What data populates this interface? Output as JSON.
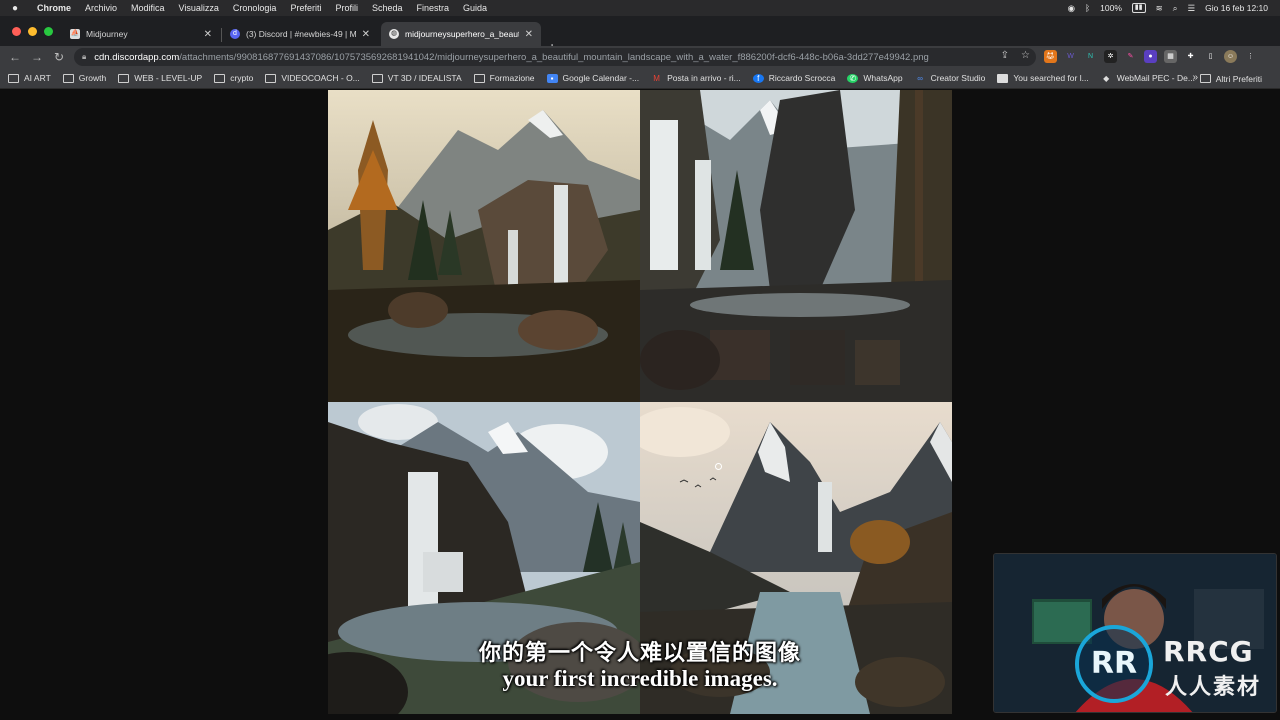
{
  "menubar": {
    "app": "Chrome",
    "items": [
      "Archivio",
      "Modifica",
      "Visualizza",
      "Cronologia",
      "Preferiti",
      "Profili",
      "Scheda",
      "Finestra",
      "Guida"
    ],
    "battery": "100%",
    "datetime": "Gio 16 feb  12:10"
  },
  "tabs": [
    {
      "title": "Midjourney",
      "active": false
    },
    {
      "title": "(3) Discord | #newbies-49 | M...",
      "active": false
    },
    {
      "title": "midjourneysuperhero_a_beauti",
      "active": true
    }
  ],
  "url": {
    "host": "cdn.discordapp.com",
    "path": "/attachments/990816877691437086/1075735692681941042/midjourneysuperhero_a_beautiful_mountain_landscape_with_a_water_f886200f-dcf6-448c-b06a-3dd277e49942.png"
  },
  "bookmarks": [
    {
      "label": "AI ART",
      "icon": "folder-icon"
    },
    {
      "label": "Growth",
      "icon": "folder-icon"
    },
    {
      "label": "WEB - LEVEL-UP",
      "icon": "folder-icon"
    },
    {
      "label": "crypto",
      "icon": "folder-icon"
    },
    {
      "label": "VIDEOCOACH - O...",
      "icon": "folder-icon"
    },
    {
      "label": "VT 3D / IDEALISTA",
      "icon": "folder-icon"
    },
    {
      "label": "Formazione",
      "icon": "folder-icon"
    },
    {
      "label": "Google Calendar -...",
      "icon": "calendar-icon"
    },
    {
      "label": "Posta in arrivo - ri...",
      "icon": "gmail-icon"
    },
    {
      "label": "Riccardo Scrocca",
      "icon": "facebook-icon"
    },
    {
      "label": "WhatsApp",
      "icon": "whatsapp-icon"
    },
    {
      "label": "Creator Studio",
      "icon": "meta-icon"
    },
    {
      "label": "You searched for l...",
      "icon": "page-icon"
    },
    {
      "label": "WebMail PEC - De...",
      "icon": "webmail-icon"
    }
  ],
  "bookmarks_more": "»",
  "bookmarks_other": "Altri Preferiti",
  "subtitles": {
    "chinese": "你的第一个令人难以置信的图像",
    "english": "your first incredible images."
  },
  "watermark": {
    "logo": "RR",
    "brand": "RRCG",
    "sub": "人人素材"
  }
}
